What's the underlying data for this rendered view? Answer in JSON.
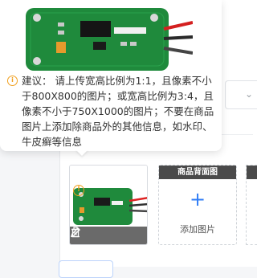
{
  "tooltip": {
    "preview_image": "green-pcb-board-product-photo",
    "info_icon": "info-icon",
    "advice_text": "建议： 请上传宽高比例为1:1，且像素不小于800X800的图片；或宽高比例为3:4，且像素不小于750X1000的图片；不要在商品图片上添加除商品外的其他信息，如水印、牛皮癣等信息"
  },
  "image_slots": [
    {
      "state": "filled",
      "image": "green-pcb-board-product-photo",
      "warning_icon": "warning-icon",
      "actions": [
        "edit-icon",
        "delete-icon"
      ]
    },
    {
      "state": "empty",
      "header": "商品背面图",
      "plus_icon": "+",
      "add_label": "添加图片"
    }
  ],
  "colors": {
    "accent": "#2f7cf6",
    "warning": "#f0a020",
    "pcb_green": "#1f8a3c",
    "header_bg": "#4a4a4a"
  }
}
